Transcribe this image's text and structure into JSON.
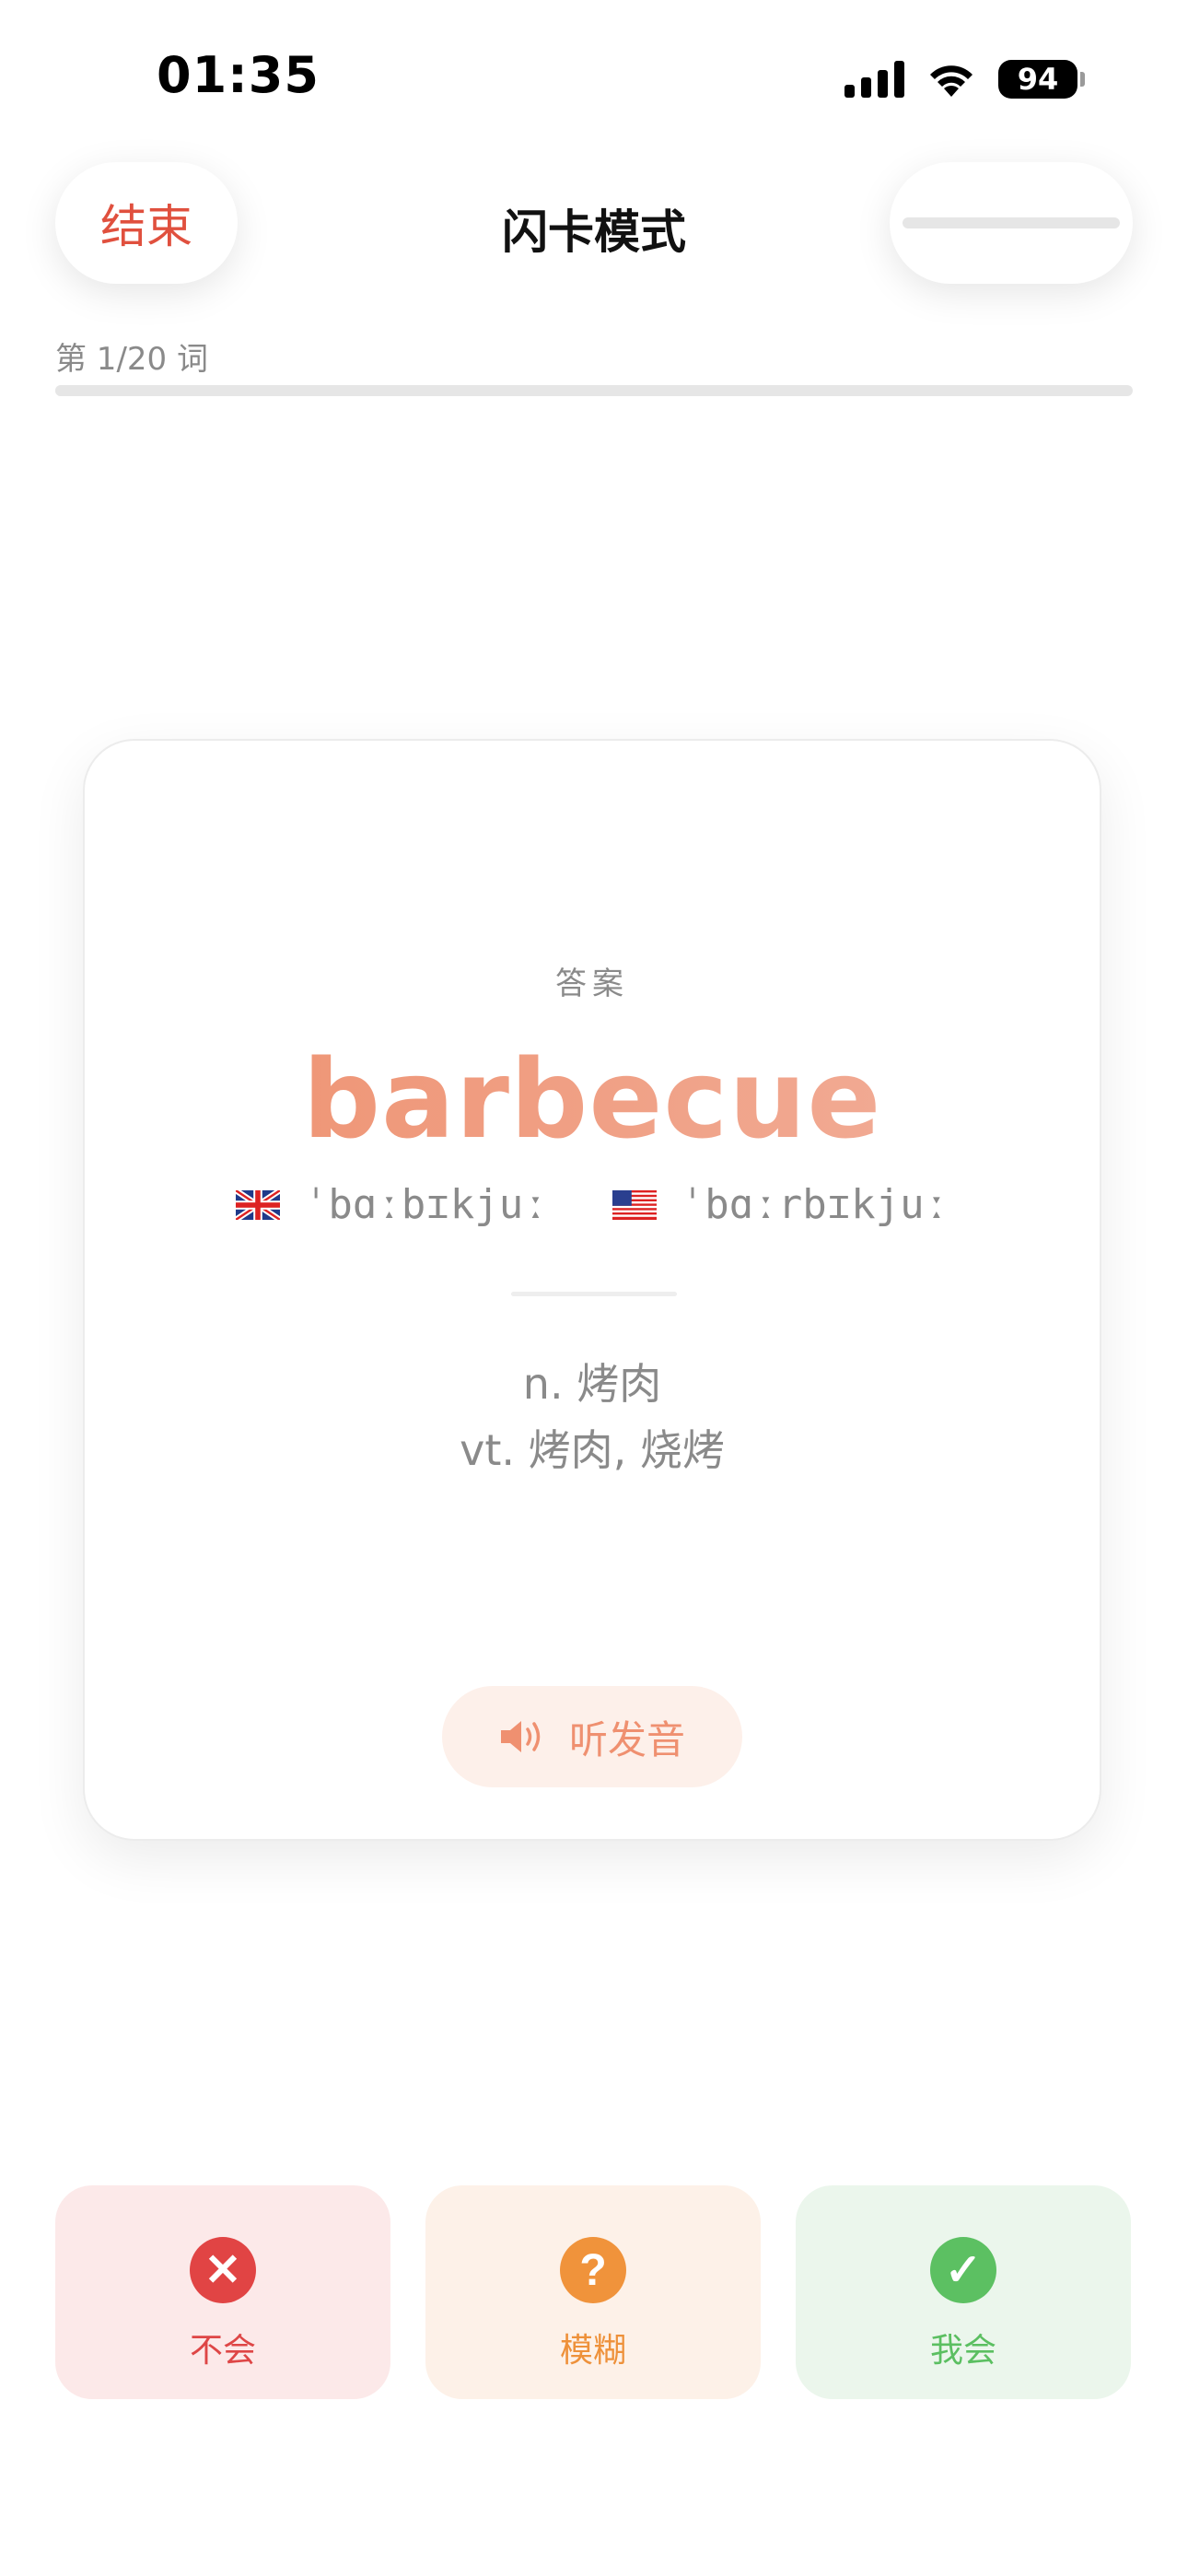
{
  "status_bar": {
    "time": "01:35",
    "battery": "94"
  },
  "header": {
    "end_label": "结束",
    "title": "闪卡模式"
  },
  "progress": {
    "label": "第 1/20 词",
    "fraction": 0.05
  },
  "card": {
    "answer_label": "答案",
    "word": "barbecue",
    "phonetic_uk": "ˈbɑːbɪkjuː",
    "phonetic_us": "ˈbɑːrbɪkjuː",
    "meanings": [
      "n. 烤肉",
      "vt. 烤肉, 烧烤"
    ],
    "listen_label": "听发音"
  },
  "choices": {
    "no_label": "不会",
    "maybe_label": "模糊",
    "yes_label": "我会"
  },
  "colors": {
    "accent": "#ef9a7a",
    "danger": "#e14444",
    "warning": "#f0933b",
    "success": "#5cc062"
  }
}
